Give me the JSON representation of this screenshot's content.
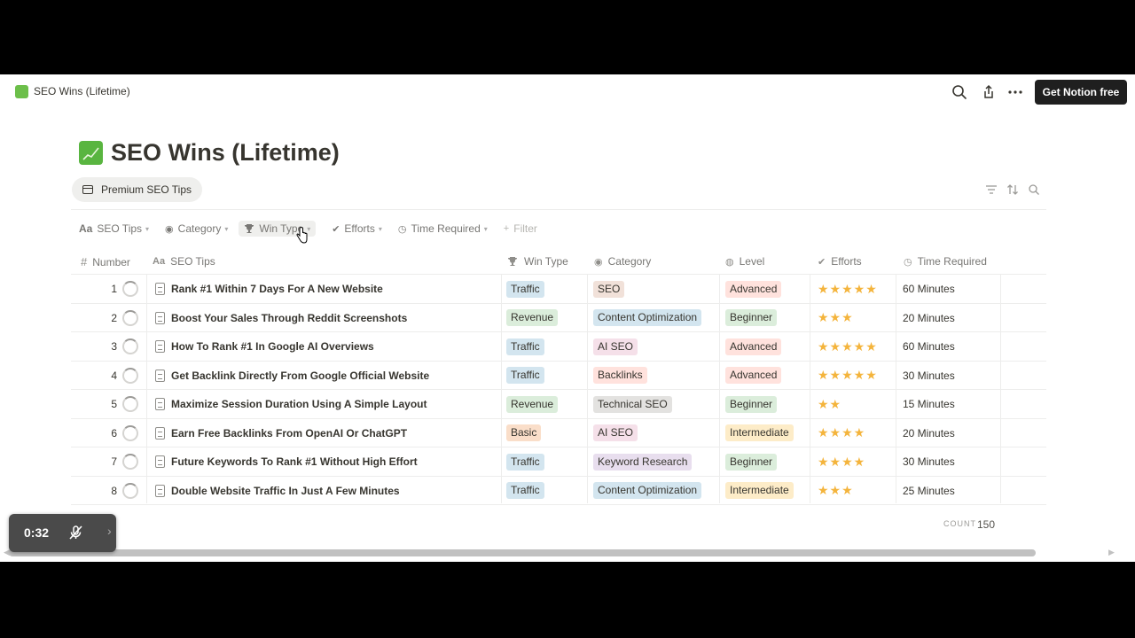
{
  "topbar": {
    "breadcrumb": "SEO Wins (Lifetime)",
    "cta_label": "Get Notion free"
  },
  "page": {
    "title": "SEO Wins (Lifetime)",
    "view_tab_label": "Premium SEO Tips"
  },
  "filters": [
    {
      "label": "SEO Tips",
      "icon": "Aa"
    },
    {
      "label": "Category",
      "icon": "◉"
    },
    {
      "label": "Win Type",
      "icon": "trophy-icon"
    },
    {
      "label": "Efforts",
      "icon": "✔"
    },
    {
      "label": "Time Required",
      "icon": "◷"
    },
    {
      "label": "Filter",
      "icon": "+"
    }
  ],
  "columns": {
    "number": "Number",
    "tips": "SEO Tips",
    "win_type": "Win Type",
    "category": "Category",
    "level": "Level",
    "efforts": "Efforts",
    "time": "Time Required"
  },
  "rows": [
    {
      "num": "1",
      "tip": "Rank #1 Within 7 Days For A New Website",
      "win": "Traffic",
      "category": "SEO",
      "level": "Advanced",
      "stars": "★★★★★",
      "time": "60 Minutes"
    },
    {
      "num": "2",
      "tip": "Boost Your Sales Through Reddit Screenshots",
      "win": "Revenue",
      "category": "Content Optimization",
      "level": "Beginner",
      "stars": "★★★",
      "time": "20 Minutes"
    },
    {
      "num": "3",
      "tip": "How To Rank #1 In Google AI Overviews",
      "win": "Traffic",
      "category": "AI SEO",
      "level": "Advanced",
      "stars": "★★★★★",
      "time": "60 Minutes"
    },
    {
      "num": "4",
      "tip": "Get Backlink Directly From Google Official Website",
      "win": "Traffic",
      "category": "Backlinks",
      "level": "Advanced",
      "stars": "★★★★★",
      "time": "30 Minutes"
    },
    {
      "num": "5",
      "tip": "Maximize Session Duration Using A Simple Layout",
      "win": "Revenue",
      "category": "Technical SEO",
      "level": "Beginner",
      "stars": "★★",
      "time": "15 Minutes"
    },
    {
      "num": "6",
      "tip": "Earn Free Backlinks From OpenAI Or ChatGPT",
      "win": "Basic",
      "category": "AI SEO",
      "level": "Intermediate",
      "stars": "★★★★",
      "time": "20 Minutes"
    },
    {
      "num": "7",
      "tip": "Future Keywords To Rank #1 Without High Effort",
      "win": "Traffic",
      "category": "Keyword Research",
      "level": "Beginner",
      "stars": "★★★★",
      "time": "30 Minutes"
    },
    {
      "num": "8",
      "tip": "Double Website Traffic In Just A Few Minutes",
      "win": "Traffic",
      "category": "Content Optimization",
      "level": "Intermediate",
      "stars": "★★★",
      "time": "25 Minutes"
    }
  ],
  "footer": {
    "count_label": "COUNT",
    "count_value": "150"
  },
  "overlay": {
    "time": "0:32"
  },
  "tag_colors": {
    "Traffic": "#d3e5ef",
    "Revenue": "#dbeddb",
    "Basic": "#fadec9",
    "SEO": "#f1e1d9",
    "Content Optimization": "#d3e5ef",
    "AI SEO": "#f5e0e9",
    "Backlinks": "#ffe2dd",
    "Technical SEO": "#e3e2e0",
    "Keyword Research": "#e8deee",
    "Advanced": "#ffe2dd",
    "Beginner": "#dbeddb",
    "Intermediate": "#fdecc8"
  }
}
